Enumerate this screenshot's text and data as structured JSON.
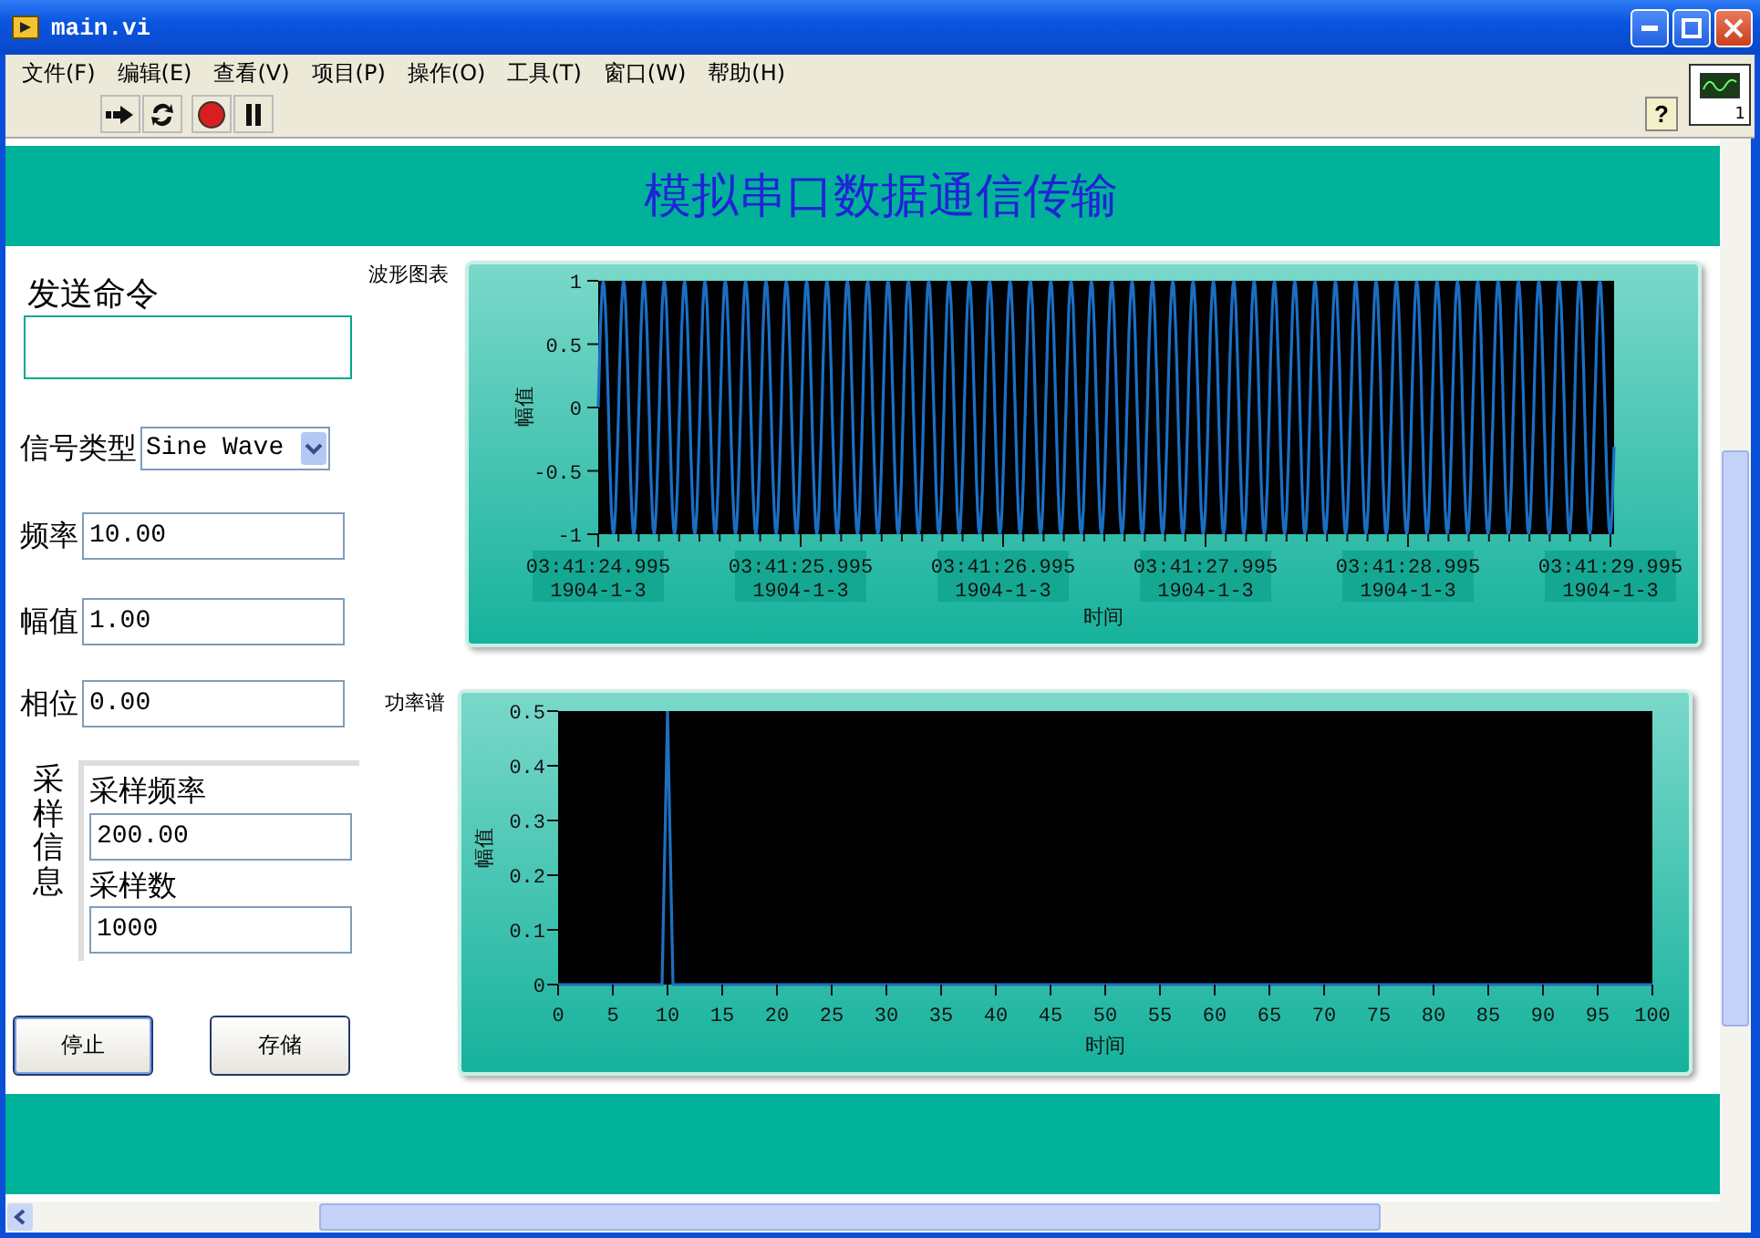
{
  "window": {
    "title": "main.vi"
  },
  "menu": [
    "文件(F)",
    "编辑(E)",
    "查看(V)",
    "项目(P)",
    "操作(O)",
    "工具(T)",
    "窗口(W)",
    "帮助(H)"
  ],
  "toolbar": [
    {
      "kind": "run"
    },
    {
      "kind": "run_continuous"
    },
    {
      "kind": "abort"
    },
    {
      "kind": "pause"
    }
  ],
  "help_button": "?",
  "vi_icon": {
    "digit": "1"
  },
  "panel": {
    "title": "模拟串口数据通信传输"
  },
  "command": {
    "label": "发送命令"
  },
  "signal_type": {
    "label": "信号类型",
    "value": "Sine Wave"
  },
  "fields": [
    {
      "label": "频率",
      "value": "10.00"
    },
    {
      "label": "幅值",
      "value": "1.00"
    },
    {
      "label": "相位",
      "value": "0.00"
    }
  ],
  "sampling": {
    "label": "采样信息",
    "fields": [
      {
        "label": "采样频率",
        "value": "200.00"
      },
      {
        "label": "采样数",
        "value": "1000"
      }
    ]
  },
  "buttons": [
    "停止",
    "存储"
  ],
  "waveform_chart": {
    "label": "波形图表",
    "ylabel": "幅值",
    "xlabel": "时间",
    "yticks": [
      "1",
      "0.5",
      "0",
      "-0.5",
      "-1"
    ],
    "xticks": [
      {
        "time": "03:41:24.995",
        "date": "1904-1-3"
      },
      {
        "time": "03:41:25.995",
        "date": "1904-1-3"
      },
      {
        "time": "03:41:26.995",
        "date": "1904-1-3"
      },
      {
        "time": "03:41:27.995",
        "date": "1904-1-3"
      },
      {
        "time": "03:41:28.995",
        "date": "1904-1-3"
      },
      {
        "time": "03:41:29.995",
        "date": "1904-1-3"
      }
    ]
  },
  "spectrum_chart": {
    "label": "功率谱",
    "chart_data": {
      "type": "line",
      "xlabel": "时间",
      "ylabel": "幅值",
      "x": [
        0,
        9.5,
        10,
        10.5,
        100
      ],
      "series": [
        {
          "color": "#1f6fc0",
          "values": [
            0,
            0,
            0.5,
            0,
            0
          ]
        }
      ],
      "xlim": [
        0,
        100
      ],
      "ylim": [
        0,
        0.5
      ],
      "xticks": [
        0,
        5,
        10,
        15,
        20,
        25,
        30,
        35,
        40,
        45,
        50,
        55,
        60,
        65,
        70,
        75,
        80,
        85,
        90,
        95,
        100
      ],
      "yticks": [
        0,
        0.1,
        0.2,
        0.3,
        0.4,
        0.5
      ]
    }
  }
}
